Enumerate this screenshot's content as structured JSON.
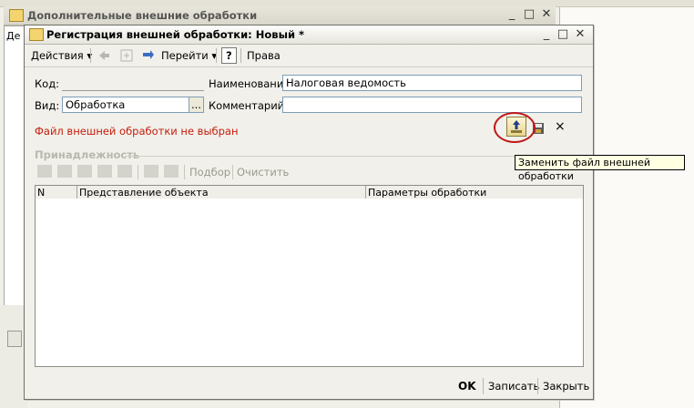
{
  "background_window": {
    "title": "Дополнительные внешние обработки",
    "left_tab_label": "Де"
  },
  "dialog": {
    "title": "Регистрация внешней обработки: Новый *",
    "toolbar": {
      "actions_label": "Действия",
      "goto_label": "Перейти",
      "help_label": "?",
      "rights_label": "Права"
    },
    "form": {
      "code_label": "Код:",
      "code_value": "",
      "name_label": "Наименование:",
      "name_value": "Налоговая ведомость",
      "kind_label": "Вид:",
      "kind_value": "Обработка",
      "kind_button": "...",
      "comment_label": "Комментарий:",
      "comment_value": ""
    },
    "file_message": "Файл внешней обработки не выбран",
    "clear_file_label": "×",
    "section_title": "Принадлежность",
    "section_toolbar": {
      "select_label": "Подбор",
      "clear_label": "Очистить"
    },
    "table": {
      "columns": [
        "N",
        "Представление объекта",
        "Параметры обработки"
      ]
    },
    "footer": {
      "ok_label": "OK",
      "save_label": "Записать",
      "close_label": "Закрыть"
    }
  },
  "tooltip": "Заменить файл внешней обработки",
  "colors": {
    "error_text": "#c41d0b",
    "highlight_circle": "#c01818",
    "tooltip_bg": "#ffffe1"
  }
}
